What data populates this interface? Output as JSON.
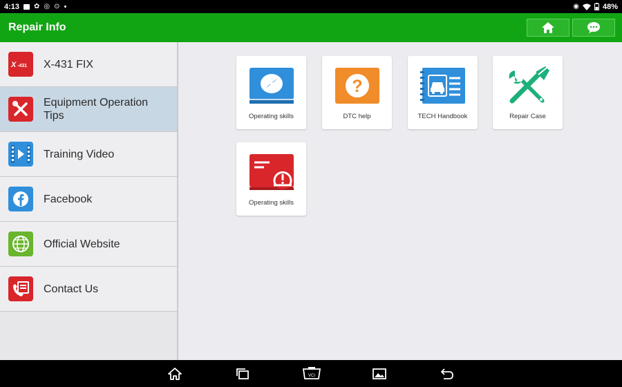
{
  "status": {
    "time": "4:13",
    "battery": "48%"
  },
  "header": {
    "title": "Repair Info"
  },
  "sidebar": {
    "items": [
      {
        "label": "X-431 FIX",
        "icon": "x431-fix-icon",
        "color": "#d8262b"
      },
      {
        "label": "Equipment Operation Tips",
        "icon": "tools-icon",
        "color": "#d8262b"
      },
      {
        "label": "Training Video",
        "icon": "video-icon",
        "color": "#2f8fdb"
      },
      {
        "label": "Facebook",
        "icon": "facebook-icon",
        "color": "#2f8fdb"
      },
      {
        "label": "Official Website",
        "icon": "www-icon",
        "color": "#6ab42e"
      },
      {
        "label": "Contact Us",
        "icon": "contact-icon",
        "color": "#d8262b"
      }
    ],
    "active_index": 1
  },
  "cards": [
    {
      "label": "Operating skills",
      "icon": "compass-book-icon",
      "color": "#2f8fdb"
    },
    {
      "label": "DTC help",
      "icon": "question-icon",
      "color": "#f08c2a"
    },
    {
      "label": "TECH Handbook",
      "icon": "car-handbook-icon",
      "color": "#2f8fdb"
    },
    {
      "label": "Repair Case",
      "icon": "wrench-screwdriver-icon",
      "color": "#1db07a"
    },
    {
      "label": "Operating skills",
      "icon": "warning-screen-icon",
      "color": "#d8262b"
    }
  ],
  "colors": {
    "header_green": "#12a513",
    "sidebar_active": "#c8d7e4"
  }
}
